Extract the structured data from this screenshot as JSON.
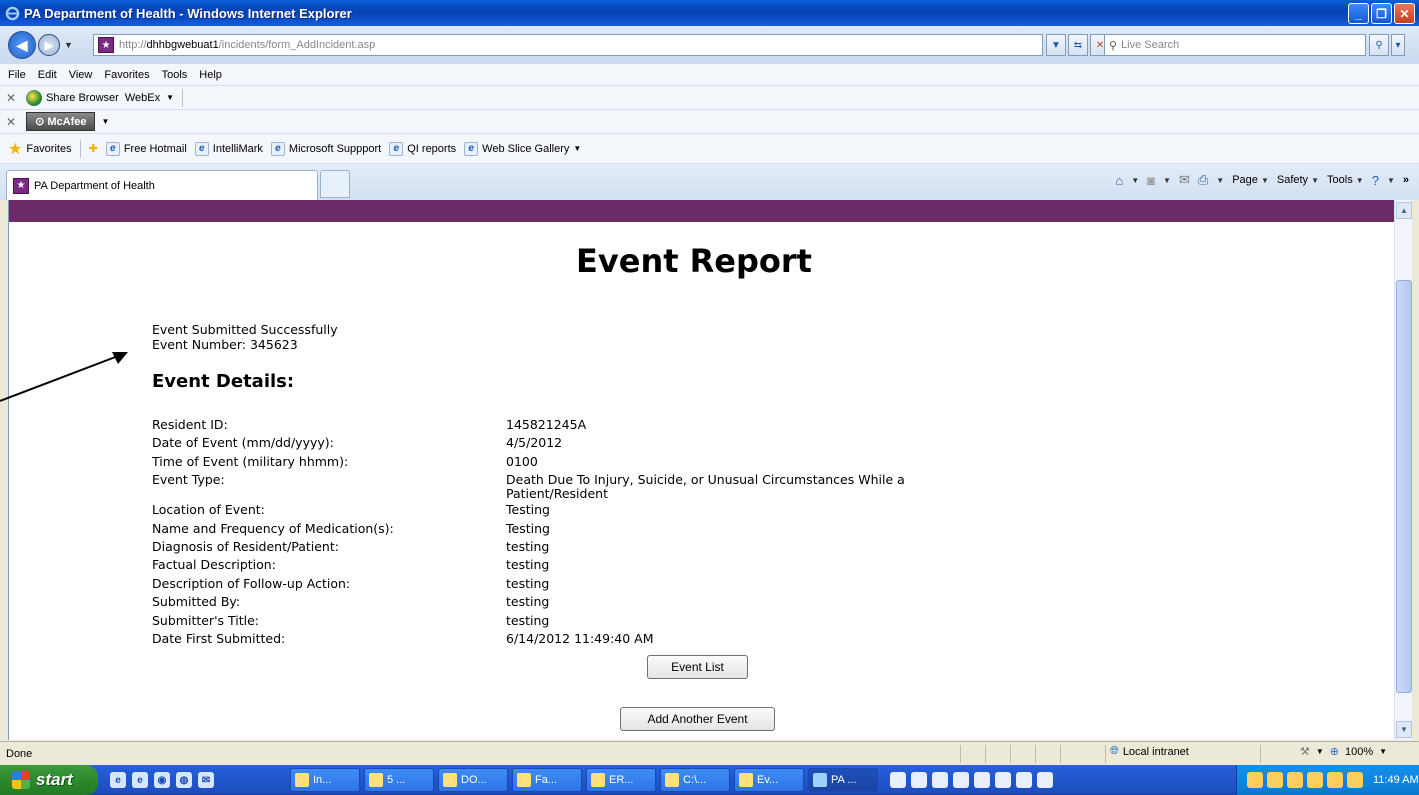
{
  "window": {
    "title": "PA Department of Health - Windows Internet Explorer"
  },
  "address": {
    "url_proto": "http://",
    "url_host": "dhhbgwebuat1",
    "url_path": "/incidents/form_AddIncident.asp",
    "search_placeholder": "Live Search"
  },
  "menu": [
    "File",
    "Edit",
    "View",
    "Favorites",
    "Tools",
    "Help"
  ],
  "toolbar1": {
    "share": "Share Browser",
    "webex": "WebEx"
  },
  "toolbar2": {
    "mcafee": "McAfee"
  },
  "favorites": {
    "label": "Favorites",
    "items": [
      "Free Hotmail",
      "IntelliMark",
      "Microsoft Suppport",
      "QI reports",
      "Web Slice Gallery"
    ]
  },
  "tab": {
    "title": "PA Department of Health"
  },
  "cmdbar": {
    "page": "Page",
    "safety": "Safety",
    "tools": "Tools"
  },
  "page": {
    "title": "Event Report",
    "success": "Event Submitted Successfully",
    "event_number": "Event Number: 345623",
    "details_heading": "Event Details:",
    "details": [
      {
        "label": "Resident ID:",
        "value": "145821245A"
      },
      {
        "label": "Date of Event (mm/dd/yyyy):",
        "value": "4/5/2012"
      },
      {
        "label": "Time of Event (military hhmm):",
        "value": "0100"
      },
      {
        "label": "Event Type:",
        "value": "Death Due To Injury, Suicide, or Unusual Circumstances While a Patient/Resident"
      },
      {
        "label": "Location of Event:",
        "value": "Testing"
      },
      {
        "label": "Name and Frequency of Medication(s):",
        "value": "Testing"
      },
      {
        "label": "Diagnosis of Resident/Patient:",
        "value": "testing"
      },
      {
        "label": "Factual Description:",
        "value": "testing"
      },
      {
        "label": "Description of Follow-up Action:",
        "value": "testing"
      },
      {
        "label": "Submitted By:",
        "value": "testing"
      },
      {
        "label": "Submitter's Title:",
        "value": "testing"
      },
      {
        "label": "Date First Submitted:",
        "value": "6/14/2012 11:49:40 AM"
      }
    ],
    "event_list_button": "Event List",
    "add_another_button": "Add Another Event"
  },
  "status": {
    "text": "Done",
    "zone": "Local intranet",
    "zoom": "100%"
  },
  "taskbar": {
    "start": "start",
    "tasks": [
      "In...",
      "5 ...",
      "DO...",
      "Fa...",
      "ER...",
      "C:\\...",
      "Ev...",
      "PA ..."
    ],
    "clock": "11:49 AM"
  }
}
